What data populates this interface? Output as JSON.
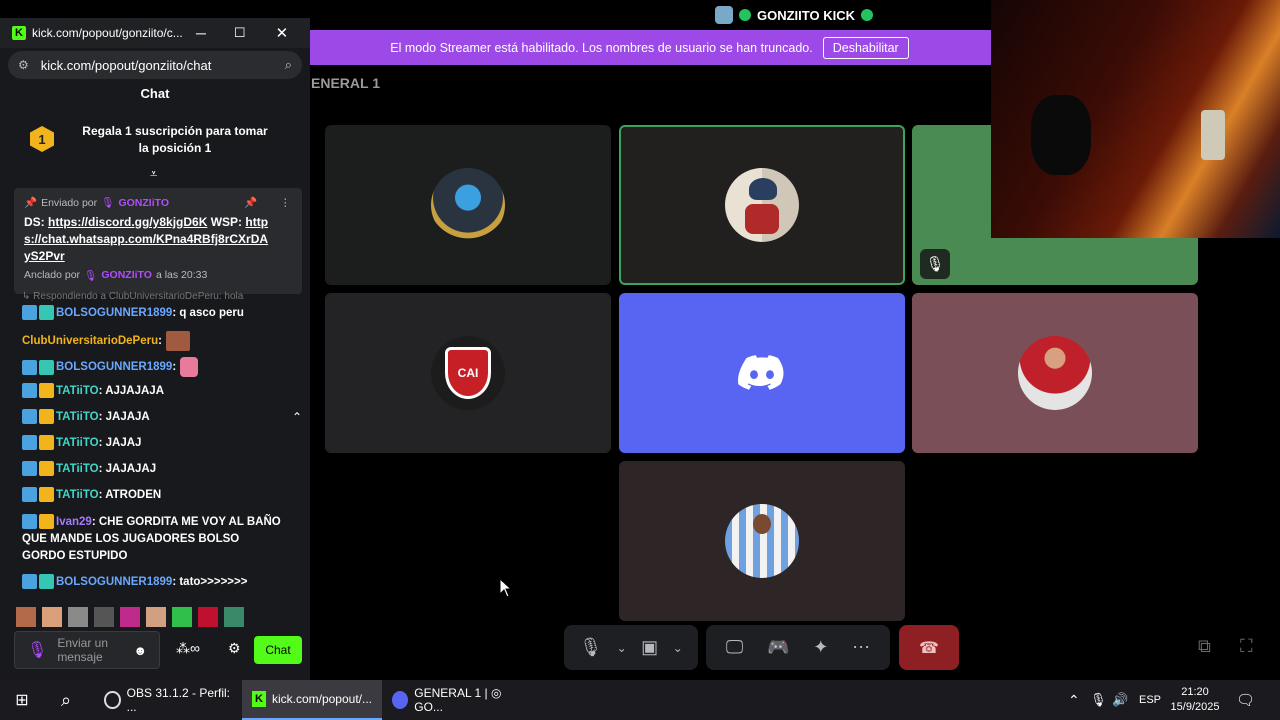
{
  "discord": {
    "title": "GONZIITO KICK",
    "streamer_notice": "El modo Streamer está habilitado. Los nombres de usuario se han truncado.",
    "streamer_button": "Deshabilitar",
    "channel_name": "ENERAL 1",
    "tiles": [
      {
        "name": "tile-1",
        "bg": "#1b1e1c",
        "icon": "avatar-trophy"
      },
      {
        "name": "tile-2",
        "bg": "#221f1f",
        "icon": "avatar-cartoon",
        "speaking": true
      },
      {
        "name": "tile-3",
        "bg": "#4a8a53",
        "icon": "muted-mic-icon"
      },
      {
        "name": "tile-4",
        "bg": "#232325",
        "icon": "avatar-independiente"
      },
      {
        "name": "tile-5",
        "bg": "#5865f2",
        "icon": "discord-logo"
      },
      {
        "name": "tile-6",
        "bg": "#7a4f58",
        "icon": "avatar-player-red"
      },
      {
        "name": "tile-7",
        "bg": "#2e2527",
        "icon": "avatar-player-stripes"
      }
    ],
    "colors": {
      "accent": "#9c49e7",
      "end_call": "#8e1f23",
      "discord": "#5865f2"
    }
  },
  "chat": {
    "window_title": "kick.com/popout/gonziito/c...",
    "url": "kick.com/popout/gonziito/chat",
    "header": "Chat",
    "gift_text": "Regala 1 suscripción para tomar la posición 1",
    "gift_badge": "1",
    "pinned": {
      "sent_by_label": "Enviado por",
      "sent_by_user": "GONZIiTO",
      "ds_label": "DS:",
      "discord_link": "https://discord.gg/y8kjgD6K",
      "wsp_label": "WSP:",
      "whatsapp_link": "https://chat.whatsapp.com/KPna4RBfj8rCXrDAyS2Pvr",
      "pinned_by_label": "Anclado por",
      "pinned_by_user": "GONZIiTO",
      "pinned_time": "a las 20:33"
    },
    "reply_hint": "Respondiendo a ClubUniversitarioDePeru: hola",
    "messages": [
      {
        "user": "BOLSOGUNNER1899",
        "text": ": q asco peru",
        "color": "u-blue",
        "badges": [
          "b1",
          "b2"
        ]
      },
      {
        "user": "ClubUniversitarioDePeru",
        "text": ":",
        "color": "u-gold",
        "badges": []
      },
      {
        "user": "BOLSOGUNNER1899",
        "text": ":",
        "color": "u-blue",
        "badges": [
          "b1",
          "b2"
        ]
      },
      {
        "user": "TATiiTO",
        "text": ": AJJAJAJA",
        "color": "u-teal",
        "badges": [
          "b1",
          "b3"
        ]
      },
      {
        "user": "TATiiTO",
        "text": ": JAJAJA",
        "color": "u-teal",
        "badges": [
          "b1",
          "b3"
        ]
      },
      {
        "user": "TATiiTO",
        "text": ": JAJAJ",
        "color": "u-teal",
        "badges": [
          "b1",
          "b3"
        ]
      },
      {
        "user": "TATiiTO",
        "text": ": JAJAJAJ",
        "color": "u-teal",
        "badges": [
          "b1",
          "b3"
        ]
      },
      {
        "user": "TATiiTO",
        "text": ": ATRODEN",
        "color": "u-teal",
        "badges": [
          "b1",
          "b3"
        ]
      },
      {
        "user": "Ivan29",
        "text": ": CHE GORDITA ME VOY AL BAÑO QUE MANDE LOS JUGADORES BOLSO GORDO ESTUPIDO",
        "color": "u-purple",
        "badges": [
          "b1",
          "b3"
        ]
      },
      {
        "user": "BOLSOGUNNER1899",
        "text": ": tato>>>>>>>",
        "color": "u-blue",
        "badges": [
          "b1",
          "b2"
        ]
      }
    ],
    "input_placeholder": "Enviar un mensaje",
    "send_label": "Chat"
  },
  "taskbar": {
    "apps": [
      {
        "label": "OBS 31.1.2 - Perfil: ...",
        "icon": "obs-icon"
      },
      {
        "label": "kick.com/popout/...",
        "icon": "kick-icon",
        "active": true
      },
      {
        "label": "GENERAL 1 | ◎ GO...",
        "icon": "discord-icon"
      }
    ],
    "lang": "ESP",
    "time": "21:20",
    "date": "15/9/2025"
  }
}
